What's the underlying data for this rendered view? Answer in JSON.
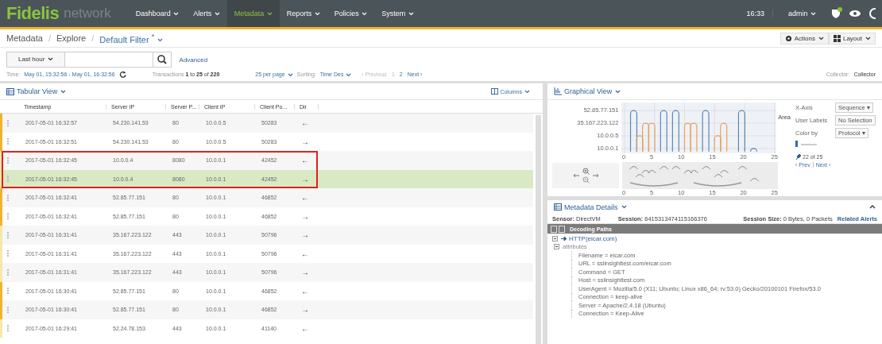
{
  "nav": {
    "logo": "Fidelis",
    "product": "network",
    "menu": [
      {
        "label": "Dashboard",
        "selected": false
      },
      {
        "label": "Alerts",
        "selected": false
      },
      {
        "label": "Metadata",
        "selected": true
      },
      {
        "label": "Reports",
        "selected": false
      },
      {
        "label": "Policies",
        "selected": false
      },
      {
        "label": "System",
        "selected": false
      }
    ],
    "time": "16:33",
    "user": "admin"
  },
  "breadcrumb": {
    "items": [
      "Metadata",
      "Explore"
    ],
    "separator": "/",
    "current": "Default Filter",
    "modified_mark": "*",
    "actions": [
      "Actions",
      "Layout"
    ]
  },
  "search": {
    "range": "Last hour",
    "advanced": "Advanced"
  },
  "info": {
    "time_label": "Time:",
    "time_range": "May 01, 15:32:56 - May 01, 16:32:56",
    "transactions_label": "Transactions",
    "transactions_from": "1",
    "transactions_to_word": "to",
    "transactions_to": "25",
    "transactions_of_word": "of",
    "transactions_total": "220",
    "per_page": "25 per page",
    "sorting_label": "Sorting:",
    "sorting": "Time Des",
    "pages": [
      {
        "label": "‹ Previous",
        "disabled": true
      },
      {
        "label": "1",
        "disabled": true
      },
      {
        "label": "2",
        "disabled": false
      },
      {
        "label": "Next ›",
        "disabled": false
      }
    ],
    "collector_label": "Collector:",
    "collector": "Collector"
  },
  "table": {
    "title": "Tabular View",
    "columns_button": "Columns",
    "columns": [
      "Timestamp",
      "Server IP",
      "Server P...",
      "Client IP",
      "Client Po...",
      "Dir"
    ],
    "rows": [
      {
        "cells": [
          "2017-05-01 16:32:57",
          "54.230.141.53",
          "80",
          "10.0.0.5",
          "50283",
          "←"
        ],
        "color": "#f0b429",
        "selected": false,
        "outlined": false
      },
      {
        "cells": [
          "2017-05-01 16:32:51",
          "54.230.141.53",
          "80",
          "10.0.0.5",
          "50283",
          "→"
        ],
        "color": "#f0b429",
        "selected": false,
        "outlined": false
      },
      {
        "cells": [
          "2017-05-01 16:32:45",
          "10.0.0.4",
          "8080",
          "10.0.0.1",
          "42452",
          "←"
        ],
        "color": "#f7e7a8",
        "selected": false,
        "outlined": true
      },
      {
        "cells": [
          "2017-05-01 16:32:45",
          "10.0.0.4",
          "8080",
          "10.0.0.1",
          "42452",
          "→"
        ],
        "color": "#f7e7a8",
        "selected": true,
        "outlined": true
      },
      {
        "cells": [
          "2017-05-01 16:32:41",
          "52.85.77.151",
          "80",
          "10.0.0.1",
          "46852",
          "←"
        ],
        "color": "#f0b429",
        "selected": false,
        "outlined": false
      },
      {
        "cells": [
          "2017-05-01 16:32:41",
          "52.85.77.151",
          "80",
          "10.0.0.1",
          "46852",
          "→"
        ],
        "color": "#f0b429",
        "selected": false,
        "outlined": false
      },
      {
        "cells": [
          "2017-05-01 16:31:41",
          "35.167.223.122",
          "443",
          "10.0.0.1",
          "50796",
          "→"
        ],
        "color": "#f7e7a8",
        "selected": false,
        "outlined": false
      },
      {
        "cells": [
          "2017-05-01 16:31:41",
          "35.167.223.122",
          "443",
          "10.0.0.1",
          "50796",
          "←"
        ],
        "color": "#f7e7a8",
        "selected": false,
        "outlined": false
      },
      {
        "cells": [
          "2017-05-01 16:31:41",
          "35.167.223.122",
          "443",
          "10.0.0.1",
          "50796",
          "→"
        ],
        "color": "#f7e7a8",
        "selected": false,
        "outlined": false
      },
      {
        "cells": [
          "2017-05-01 16:30:41",
          "52.85.77.151",
          "80",
          "10.0.0.1",
          "46852",
          "←"
        ],
        "color": "#f0b429",
        "selected": false,
        "outlined": false
      },
      {
        "cells": [
          "2017-05-01 16:30:41",
          "52.85.77.151",
          "80",
          "10.0.0.1",
          "46852",
          "→"
        ],
        "color": "#f0b429",
        "selected": false,
        "outlined": false
      },
      {
        "cells": [
          "2017-05-01 16:29:41",
          "52.24.78.153",
          "443",
          "10.0.0.1",
          "41140",
          "←"
        ],
        "color": "#f7e7a8",
        "selected": false,
        "outlined": false
      }
    ]
  },
  "graph": {
    "title": "Graphical View",
    "y_labels": [
      "52.85.77.151",
      "35.167.223.122",
      "10.0.0.5",
      "10.0.0.1"
    ],
    "x_labels": [
      "0",
      "5",
      "10",
      "15",
      "20",
      "25"
    ],
    "overview_x_labels": [
      "0",
      "5",
      "10",
      "15",
      "20",
      "25"
    ],
    "end_label": "Area",
    "settings": [
      {
        "label": "X-Axis",
        "value": "Sequence ▾"
      },
      {
        "label": "User Labels",
        "value": "No Selection"
      },
      {
        "label": "Color by",
        "value": "Protocol ▾"
      }
    ],
    "position": "22 of 25",
    "prev": "‹ Prev",
    "next": "Next ›"
  },
  "details": {
    "title": "Metadata Details",
    "sensor_label": "Sensor:",
    "sensor": "DirectVM",
    "session_label": "Session:",
    "session": "6415313474115166376",
    "size_label": "Session Size:",
    "size": "0 Bytes, 0 Packets",
    "related": "Related Alerts",
    "paths_title": "Decoding Paths",
    "tree": [
      {
        "label": "HTTP(eicar.com)",
        "expanded": true,
        "children": [
          {
            "label": "attributes",
            "expanded": true,
            "children": [
              {
                "label": "Filename = eicar.com"
              },
              {
                "label": "URL = sslinsighttest.com/eicar.com"
              },
              {
                "label": "Command = GET"
              },
              {
                "label": "Host = sslinsighttest.com"
              },
              {
                "label": "UserAgent = Mozilla/5.0 (X11; Ubuntu; Linux x86_64; rv:53.0) Gecko/20100101 Firefox/53.0"
              },
              {
                "label": "Connection = keep-alive"
              },
              {
                "label": "Server = Apache/2.4.18 (Ubuntu)"
              },
              {
                "label": "Connection = Keep-Alive"
              }
            ]
          }
        ]
      }
    ]
  }
}
